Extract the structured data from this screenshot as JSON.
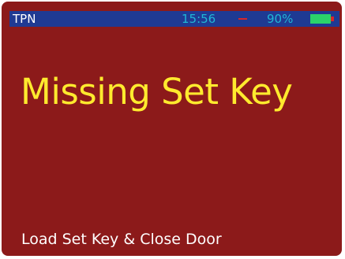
{
  "status_bar": {
    "device_name": "TPN",
    "time": "15:56",
    "separator": "—",
    "battery_percent": "90%",
    "battery_icon": "battery-icon",
    "colors": {
      "bar": "#1f3a93",
      "time": "#1fb7d6",
      "separator": "#d8262a",
      "battery_fill": "#2bd36a"
    }
  },
  "screen": {
    "title": "Missing Set Key",
    "instruction": "Load Set Key & Close Door",
    "colors": {
      "background": "#8c1a1a",
      "title": "#ffea2e",
      "instruction": "#ffffff"
    }
  }
}
